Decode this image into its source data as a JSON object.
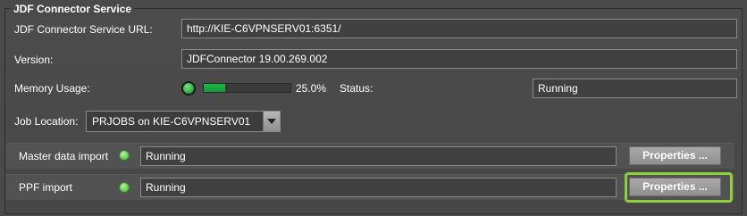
{
  "panel": {
    "title": "JDF Connector Service"
  },
  "service_url": {
    "label": "JDF Connector Service URL:",
    "value": "http://KIE-C6VPNSERV01:6351/"
  },
  "version": {
    "label": "Version:",
    "value": "JDFConnector 19.00.269.002"
  },
  "memory": {
    "label": "Memory Usage:",
    "percent_text": "25.0%",
    "fill_fraction": 0.25
  },
  "status": {
    "label": "Status:",
    "value": "Running"
  },
  "job_location": {
    "label": "Job Location:",
    "selected": "PRJOBS on KIE-C6VPNSERV01"
  },
  "imports": [
    {
      "label": "Master data import",
      "status": "Running",
      "button": "Properties ..."
    },
    {
      "label": "PPF import",
      "status": "Running",
      "button": "Properties ..."
    }
  ],
  "colors": {
    "indicator_green": "#5cc84a",
    "progress_green": "#1aa33f",
    "focus_ring": "#8ed03c"
  }
}
